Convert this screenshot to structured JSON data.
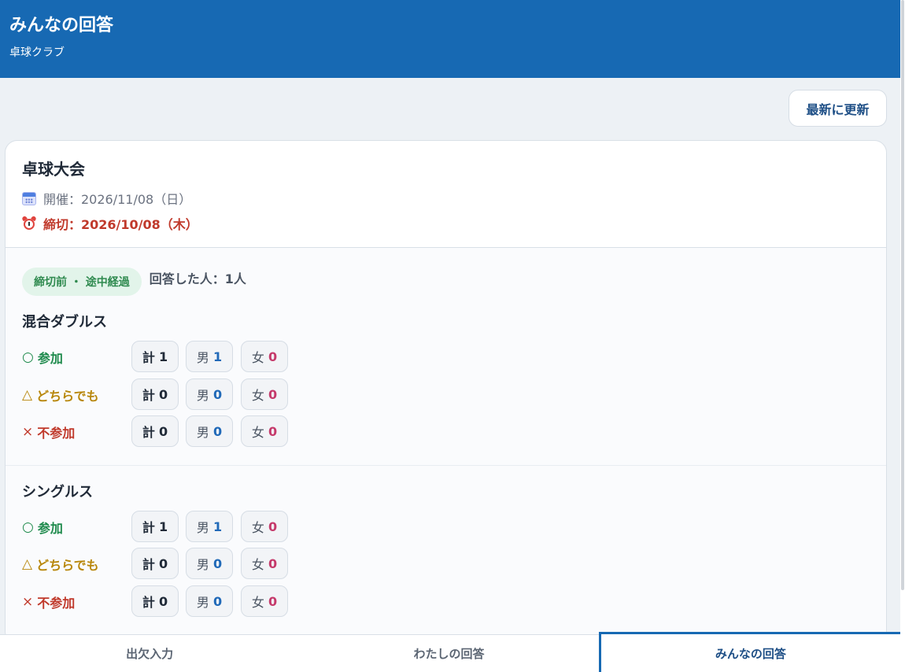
{
  "header": {
    "title": "みんなの回答",
    "subtitle": "卓球クラブ"
  },
  "toolbar": {
    "refresh_label": "最新に更新"
  },
  "event": {
    "title": "卓球大会",
    "date_text": "開催：2026/11/08（日）",
    "deadline_text": "締切：2026/10/08（木）",
    "status_badge": "締切前 ・ 途中経過",
    "respondents": "回答した人：1人"
  },
  "sections": [
    {
      "title": "混合ダブルス",
      "rows": [
        {
          "symbol": "○",
          "label": "参加",
          "total_label": "計",
          "total": "1",
          "male_label": "男",
          "male": "1",
          "female_label": "女",
          "female": "0"
        },
        {
          "symbol": "△",
          "label": "どちらでも",
          "total_label": "計",
          "total": "0",
          "male_label": "男",
          "male": "0",
          "female_label": "女",
          "female": "0"
        },
        {
          "symbol": "×",
          "label": "不参加",
          "total_label": "計",
          "total": "0",
          "male_label": "男",
          "male": "0",
          "female_label": "女",
          "female": "0"
        }
      ]
    },
    {
      "title": "シングルス",
      "rows": [
        {
          "symbol": "○",
          "label": "参加",
          "total_label": "計",
          "total": "1",
          "male_label": "男",
          "male": "1",
          "female_label": "女",
          "female": "0"
        },
        {
          "symbol": "△",
          "label": "どちらでも",
          "total_label": "計",
          "total": "0",
          "male_label": "男",
          "male": "0",
          "female_label": "女",
          "female": "0"
        },
        {
          "symbol": "×",
          "label": "不参加",
          "total_label": "計",
          "total": "0",
          "male_label": "男",
          "male": "0",
          "female_label": "女",
          "female": "0"
        }
      ]
    }
  ],
  "tabs": [
    {
      "label": "出欠入力"
    },
    {
      "label": "わたしの回答"
    },
    {
      "label": "みんなの回答"
    }
  ],
  "icons": {
    "date": "calendar-icon",
    "deadline": "alarm-clock-icon"
  },
  "colors": {
    "header_bg": "#1769b3",
    "attend": "#1e8a4c",
    "maybe": "#b8870b",
    "absent": "#c0392b",
    "male": "#2069b8",
    "female": "#c53a6b"
  }
}
